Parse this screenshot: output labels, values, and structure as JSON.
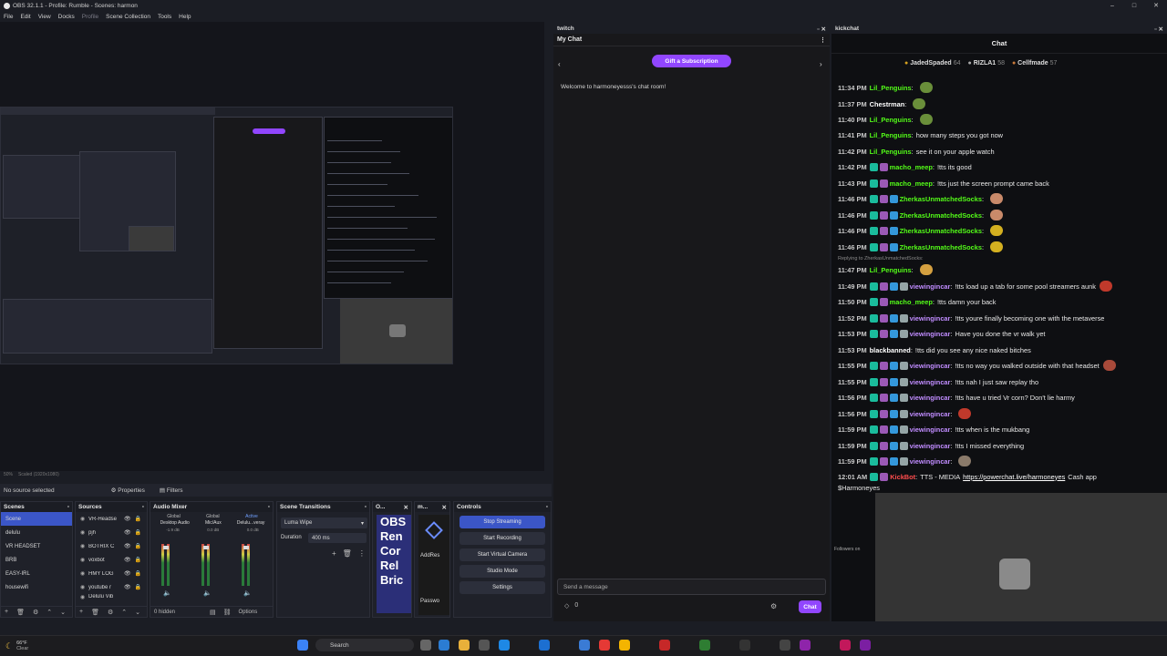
{
  "window": {
    "title": "OBS 32.1.1 - Profile: Rumble - Scenes: harmon",
    "controls": [
      "–",
      "□",
      "✕"
    ]
  },
  "menu": [
    {
      "label": "File"
    },
    {
      "label": "Edit"
    },
    {
      "label": "View"
    },
    {
      "label": "Docks"
    },
    {
      "label": "Profile",
      "dim": true
    },
    {
      "label": "Scene Collection"
    },
    {
      "label": "Tools"
    },
    {
      "label": "Help"
    }
  ],
  "preview_footer": {
    "zoom": "50%",
    "scale": "Scaled (1920x1080)"
  },
  "source_bar": {
    "no_source": "No source selected",
    "properties": "Properties",
    "filters": "Filters"
  },
  "scenes": {
    "title": "Scenes",
    "items": [
      "Scene",
      "delulu",
      "VR HEADSET",
      "BRB",
      "EASY-IRL",
      "housewifi"
    ],
    "selected": 0
  },
  "sources": {
    "title": "Sources",
    "items": [
      "VR-Headse",
      "pjh",
      "BOTRIX C",
      "voxbot",
      "HMY LOG",
      "youtube r",
      "Delulu Vib"
    ]
  },
  "mixer": {
    "title": "Audio Mixer",
    "channels": [
      {
        "tag": "Global",
        "name": "Desktop Audio",
        "db": "-1.9 dB"
      },
      {
        "tag": "Global",
        "name": "Mic/Aux",
        "db": "0.0 dB"
      },
      {
        "tag": "Active",
        "name": "Delulu...veray",
        "db": "0.0 dB"
      }
    ],
    "footer_hidden": "0 hidden",
    "options": "Options"
  },
  "transitions": {
    "title": "Scene Transitions",
    "selected": "Luma Wipe",
    "duration_label": "Duration",
    "duration": "400 ms"
  },
  "obsdock": {
    "title": "O...",
    "text": [
      "OBS",
      "Ren",
      "Cor",
      "Rel",
      "Bric"
    ]
  },
  "mdock": {
    "title": "m...",
    "addr": "AddRes",
    "pwd": "Passwo"
  },
  "controls": {
    "title": "Controls",
    "buttons": [
      "Stop Streaming",
      "Start Recording",
      "Start Virtual Camera",
      "Studio Mode",
      "Settings"
    ]
  },
  "twitch": {
    "dock_title": "twitch",
    "chat_title": "My Chat",
    "gift": "Gift a Subscription",
    "welcome": "Welcome to harmoneyesss's chat room!",
    "send_placeholder": "Send a message",
    "points": "0",
    "chat_button": "Chat"
  },
  "kick": {
    "dock_title": "kickchat",
    "chat_title": "Chat",
    "leaders": [
      {
        "name": "JadedSpaded",
        "count": "64"
      },
      {
        "name": "RIZLA1",
        "count": "58"
      },
      {
        "name": "Cellfmade",
        "count": "57"
      }
    ],
    "messages": [
      {
        "time": "11:34 PM",
        "user": "Lil_Penguins",
        "color": "#53fc18",
        "text": "",
        "emote": "#6a8f3a"
      },
      {
        "time": "11:37 PM",
        "user": "Chestrman",
        "color": "#ffffff",
        "text": "",
        "emote": "#6a8f3a"
      },
      {
        "time": "11:40 PM",
        "user": "Lil_Penguins",
        "color": "#53fc18",
        "text": "",
        "emote": "#6a8f3a"
      },
      {
        "time": "11:41 PM",
        "user": "Lil_Penguins",
        "color": "#53fc18",
        "text": "how many steps you got now"
      },
      {
        "time": "11:42 PM",
        "user": "Lil_Penguins",
        "color": "#53fc18",
        "text": "see it on your apple watch"
      },
      {
        "time": "11:42 PM",
        "user": "macho_meep",
        "color": "#53fc18",
        "text": "!tts its good",
        "badges": 2
      },
      {
        "time": "11:43 PM",
        "user": "macho_meep",
        "color": "#53fc18",
        "text": "!tts just the screen prompt came back",
        "badges": 2
      },
      {
        "time": "11:46 PM",
        "user": "ZherkasUnmatchedSocks",
        "color": "#53fc18",
        "text": "",
        "badges": 3,
        "emote": "#c98a6a"
      },
      {
        "time": "11:46 PM",
        "user": "ZherkasUnmatchedSocks",
        "color": "#53fc18",
        "text": "",
        "badges": 3,
        "emote": "#c98a6a"
      },
      {
        "time": "11:46 PM",
        "user": "ZherkasUnmatchedSocks",
        "color": "#53fc18",
        "text": "",
        "badges": 3,
        "emote": "#d4b020"
      },
      {
        "time": "11:46 PM",
        "user": "ZherkasUnmatchedSocks",
        "color": "#53fc18",
        "text": "",
        "badges": 3,
        "emote": "#d4b020"
      },
      {
        "reply": "Replying to ZherkasUnmatchedSocks:"
      },
      {
        "time": "11:47 PM",
        "user": "Lil_Penguins",
        "color": "#53fc18",
        "text": "",
        "emote": "#d4a040"
      },
      {
        "time": "11:49 PM",
        "user": "viewingincar",
        "color": "#c08cff",
        "text": "!tts load up a tab for some pool streamers aunk",
        "badges": 4,
        "emote": "#c0392b"
      },
      {
        "time": "11:50 PM",
        "user": "macho_meep",
        "color": "#53fc18",
        "text": "!tts damn your back",
        "badges": 2
      },
      {
        "time": "11:52 PM",
        "user": "viewingincar",
        "color": "#c08cff",
        "text": "!tts youre finally becoming one with the metaverse",
        "badges": 4
      },
      {
        "time": "11:53 PM",
        "user": "viewingincar",
        "color": "#c08cff",
        "text": "Have you done the vr walk yet",
        "badges": 4
      },
      {
        "time": "11:53 PM",
        "user": "blackbanned",
        "color": "#ffffff",
        "text": "!tts did you see any nice naked bitches"
      },
      {
        "time": "11:55 PM",
        "user": "viewingincar",
        "color": "#c08cff",
        "text": "!tts no way you walked outside with that headset",
        "badges": 4,
        "emote": "#a84a3a"
      },
      {
        "time": "11:55 PM",
        "user": "viewingincar",
        "color": "#c08cff",
        "text": "!tts nah I just saw replay tho",
        "badges": 4
      },
      {
        "time": "11:56 PM",
        "user": "viewingincar",
        "color": "#c08cff",
        "text": "!tts have u tried Vr corn? Don't lie harmy",
        "badges": 4
      },
      {
        "time": "11:56 PM",
        "user": "viewingincar",
        "color": "#c08cff",
        "text": "",
        "badges": 4,
        "emote": "#c0392b"
      },
      {
        "time": "11:59 PM",
        "user": "viewingincar",
        "color": "#c08cff",
        "text": "!tts when is the mukbang",
        "badges": 4
      },
      {
        "time": "11:59 PM",
        "user": "viewingincar",
        "color": "#c08cff",
        "text": "!tts I missed everything",
        "badges": 4
      },
      {
        "time": "11:59 PM",
        "user": "viewingincar",
        "color": "#c08cff",
        "text": "",
        "badges": 4,
        "emote": "#8a7a6a"
      },
      {
        "time": "12:01 AM",
        "user": "KickBot",
        "color": "#ff4d4d",
        "text": "TTS - MEDIA",
        "link": "https://powerchat.live/harmoneyes",
        "tail": "Cash app",
        "line2": "$Harmoneyes",
        "badges": 2
      }
    ],
    "followers": "Followers on"
  },
  "taskbar": {
    "weather_temp": "66°F",
    "weather_desc": "Clear",
    "search": "Search"
  }
}
